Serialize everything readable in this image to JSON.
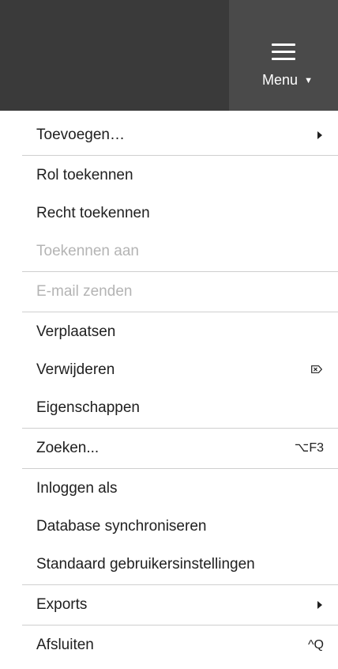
{
  "header": {
    "menu_label": "Menu",
    "menu_caret": "▼",
    "hamburger_icon": "hamburger-icon"
  },
  "colors": {
    "topbar": "#3a3a3a",
    "menu_button": "#4a4a4a",
    "text": "#202020",
    "disabled_text": "#b4b4b4",
    "divider": "#cfcfcf"
  },
  "menu": {
    "add": {
      "label": "Toevoegen…",
      "submenu_icon": "chevron-right-icon"
    },
    "assign_role": {
      "label": "Rol toekennen"
    },
    "assign_right": {
      "label": "Recht toekennen"
    },
    "assign_to": {
      "label": "Toekennen aan",
      "disabled": true
    },
    "send_email": {
      "label": "E-mail zenden",
      "disabled": true
    },
    "move": {
      "label": "Verplaatsen"
    },
    "delete": {
      "label": "Verwijderen",
      "shortcut_icon": "delete-key-icon"
    },
    "properties": {
      "label": "Eigenschappen"
    },
    "search": {
      "label": "Zoeken...",
      "shortcut": "⌥F3"
    },
    "login_as": {
      "label": "Inloggen als"
    },
    "sync_db": {
      "label": "Database synchroniseren"
    },
    "default_settings": {
      "label": "Standaard gebruikersinstellingen"
    },
    "exports": {
      "label": "Exports",
      "submenu_icon": "chevron-right-icon"
    },
    "close": {
      "label": "Afsluiten",
      "shortcut": "^Q"
    }
  }
}
